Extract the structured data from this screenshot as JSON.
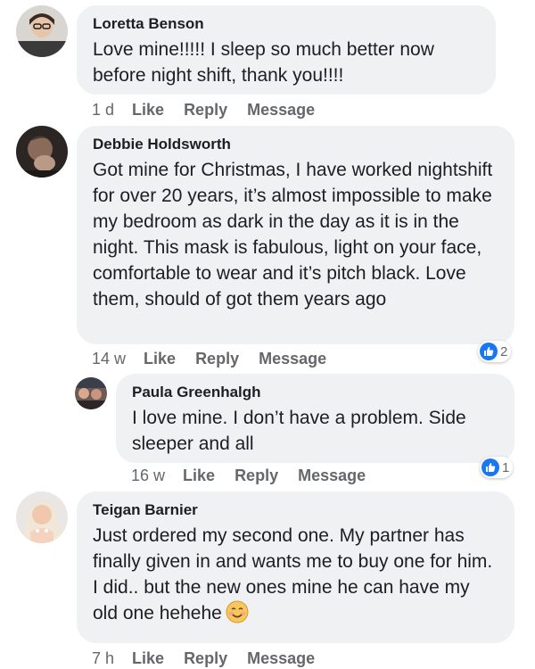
{
  "comments": [
    {
      "author": "Loretta Benson",
      "text": "Love mine!!!!!  I sleep so much better now before night shift, thank you!!!!",
      "time": "1 d",
      "like": "Like",
      "reply": "Reply",
      "message": "Message"
    },
    {
      "author": "Debbie Holdsworth",
      "text": "Got mine for Christmas, I have worked nightshift for over 20 years, it’s almost impossible to make my bedroom  as dark in the day as it is in the night. This mask is fabulous, light on your face, comfortable to wear and it’s pitch black. Love them, should of got them years ago",
      "time": "14 w",
      "like": "Like",
      "reply": "Reply",
      "message": "Message",
      "reaction_count": "2"
    },
    {
      "author": "Paula Greenhalgh",
      "text": "I love mine. I don’t have a problem. Side sleeper and all",
      "time": "16 w",
      "like": "Like",
      "reply": "Reply",
      "message": "Message",
      "reaction_count": "1"
    },
    {
      "author": "Teigan Barnier",
      "text": "Just ordered my second one. My partner has finally given in and wants me to buy one for him. I did.. but the new ones mine he can have my old one hehehe",
      "time": "7 h",
      "like": "Like",
      "reply": "Reply",
      "message": "Message",
      "emoji": "smiling-face-emoji"
    }
  ],
  "colors": {
    "bubble": "#f0f1f3",
    "meta_text": "#65676b",
    "like_blue": "#1877f2"
  }
}
